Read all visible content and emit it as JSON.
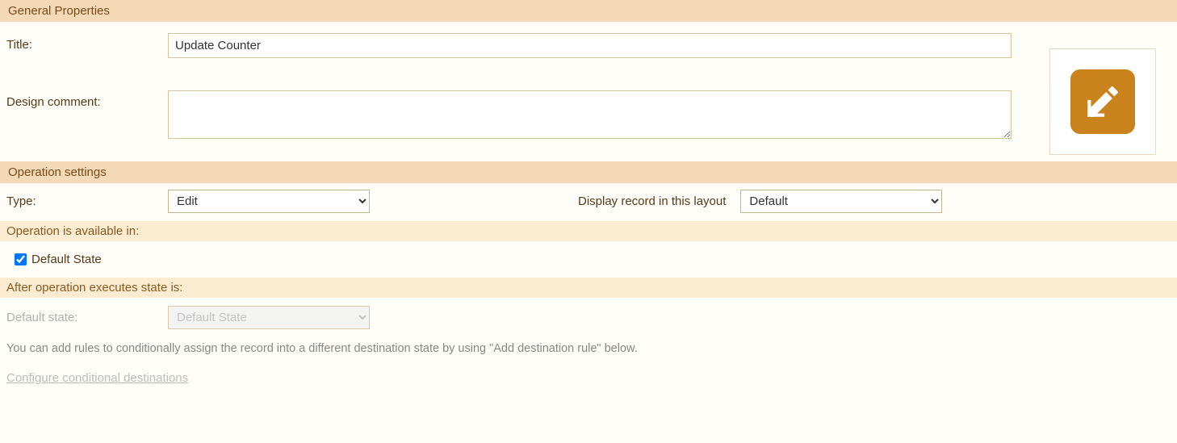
{
  "sections": {
    "general": {
      "header": "General Properties",
      "title_label": "Title:",
      "title_value": "Update Counter",
      "comment_label": "Design comment:",
      "comment_value": ""
    },
    "operation": {
      "header": "Operation settings",
      "type_label": "Type:",
      "type_value": "Edit",
      "layout_label": "Display record in this layout",
      "layout_value": "Default"
    },
    "available": {
      "header": "Operation is available in:",
      "default_state_label": "Default State",
      "default_state_checked": true
    },
    "after": {
      "header": "After operation executes state is:",
      "default_state_label": "Default state:",
      "default_state_value": "Default State",
      "help_text": "You can add rules to conditionally assign the record into a different destination state by using \"Add destination rule\" below.",
      "configure_link": "Configure conditional destinations"
    }
  }
}
